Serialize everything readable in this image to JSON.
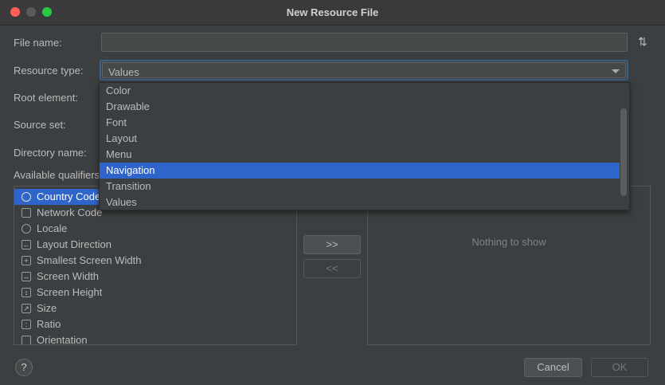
{
  "window": {
    "title": "New Resource File"
  },
  "form": {
    "file_name_label": "File name:",
    "file_name_value": "",
    "resource_type_label": "Resource type:",
    "resource_type_value": "Values",
    "root_element_label": "Root element:",
    "source_set_label": "Source set:",
    "directory_name_label": "Directory name:",
    "available_qualifiers_label": "Available qualifiers:"
  },
  "dropdown": {
    "options": [
      "Color",
      "Drawable",
      "Font",
      "Layout",
      "Menu",
      "Navigation",
      "Transition",
      "Values"
    ],
    "highlighted": "Navigation"
  },
  "qualifiers": {
    "items": [
      {
        "label": "Country Code",
        "icon": "country-code-icon",
        "selected": true
      },
      {
        "label": "Network Code",
        "icon": "network-code-icon"
      },
      {
        "label": "Locale",
        "icon": "globe-icon"
      },
      {
        "label": "Layout Direction",
        "icon": "layout-direction-icon"
      },
      {
        "label": "Smallest Screen Width",
        "icon": "smallest-width-icon"
      },
      {
        "label": "Screen Width",
        "icon": "screen-width-icon"
      },
      {
        "label": "Screen Height",
        "icon": "screen-height-icon"
      },
      {
        "label": "Size",
        "icon": "size-icon"
      },
      {
        "label": "Ratio",
        "icon": "ratio-icon"
      },
      {
        "label": "Orientation",
        "icon": "orientation-icon"
      }
    ]
  },
  "transfer": {
    "add_label": ">>",
    "remove_label": "<<"
  },
  "chosen": {
    "empty_text": "Nothing to show"
  },
  "footer": {
    "help_label": "?",
    "cancel_label": "Cancel",
    "ok_label": "OK"
  },
  "colors": {
    "selection": "#2f65ca",
    "focus_border": "#3d6185",
    "background": "#3c3f41"
  }
}
